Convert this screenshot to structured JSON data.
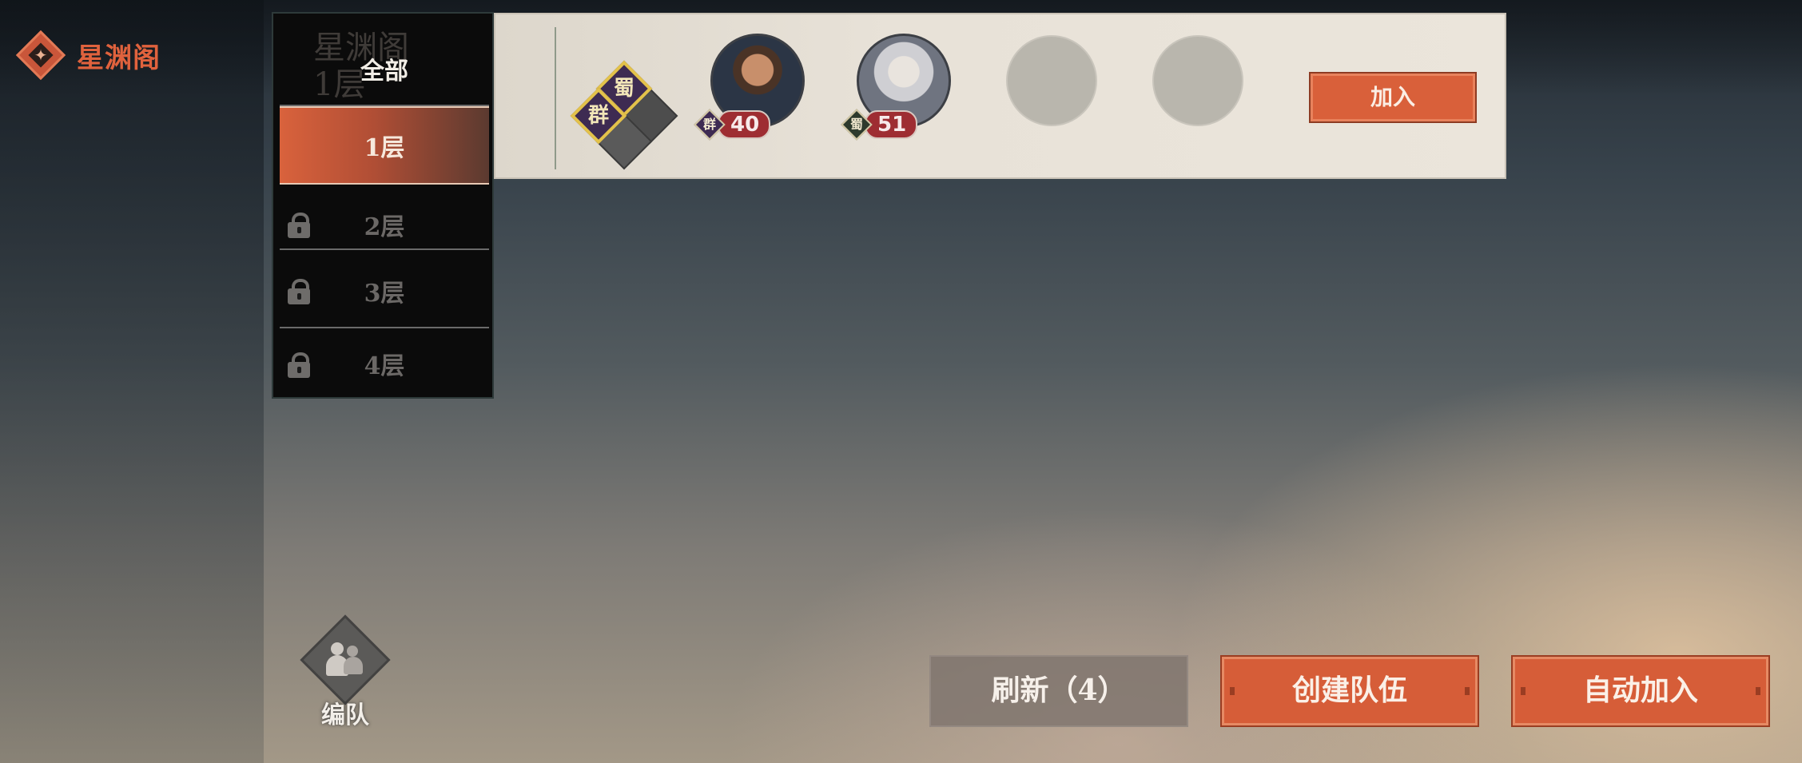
{
  "app": {
    "title": "星渊阁"
  },
  "floor_menu": {
    "ghost_text": "星渊阁\n1层",
    "items": [
      {
        "label": "全部",
        "state": "normal"
      },
      {
        "label": "1层",
        "state": "active"
      },
      {
        "label": "2层",
        "state": "locked"
      },
      {
        "label": "3层",
        "state": "locked"
      },
      {
        "label": "4层",
        "state": "locked"
      }
    ]
  },
  "team": {
    "factions": [
      "蜀",
      "群"
    ],
    "members": [
      {
        "faction": "群",
        "level": "40"
      },
      {
        "faction": "蜀",
        "level": "51"
      }
    ],
    "empty_slots": 2,
    "join_label": "加入"
  },
  "bottom": {
    "formation_label": "编队",
    "refresh_label": "刷新（4）",
    "create_label": "创建队伍",
    "auto_join_label": "自动加入"
  },
  "colors": {
    "accent": "#d9603a",
    "faction_qun": "#3e2b52",
    "faction_shu": "#2d3a2c",
    "level_badge": "#9e2d32"
  }
}
